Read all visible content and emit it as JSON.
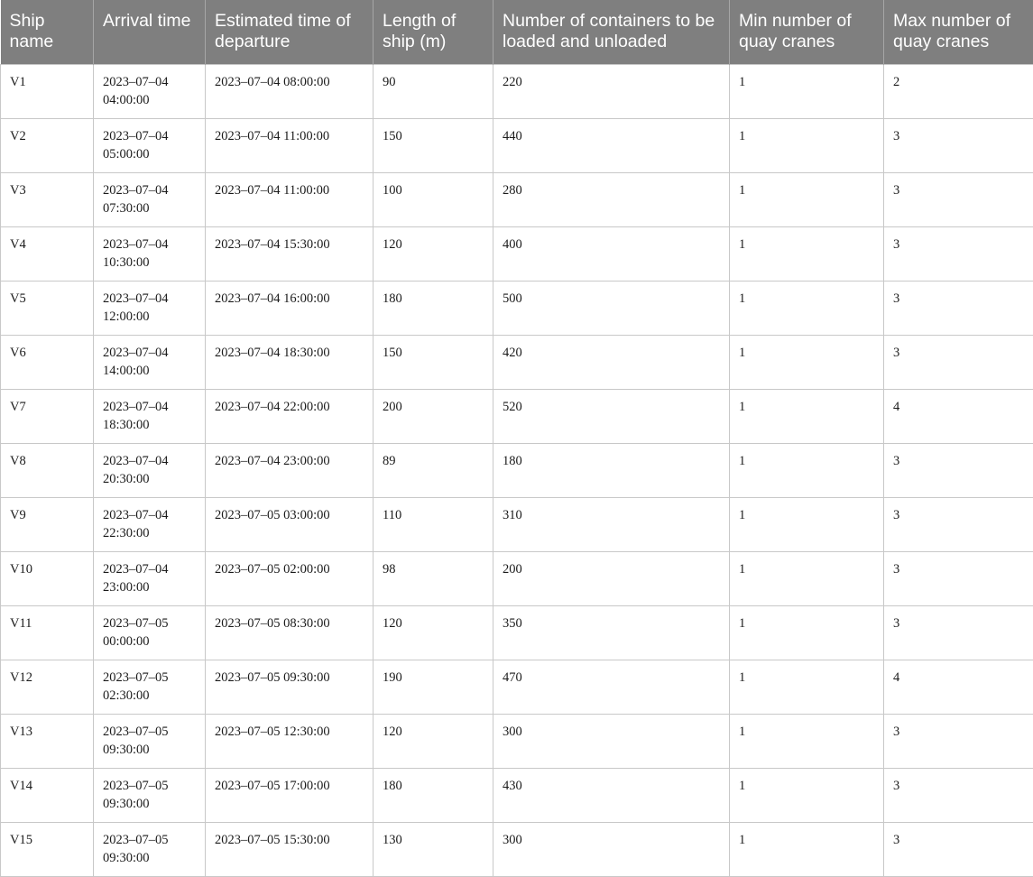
{
  "table": {
    "headers": [
      "Ship name",
      "Arrival time",
      "Estimated time of departure",
      "Length of ship (m)",
      "Number of containers to be loaded and unloaded",
      "Min number of quay cranes",
      "Max number of quay cranes"
    ],
    "rows": [
      [
        "V1",
        "2023–07–04 04:00:00",
        "2023–07–04 08:00:00",
        "90",
        "220",
        "1",
        "2"
      ],
      [
        "V2",
        "2023–07–04 05:00:00",
        "2023–07–04 11:00:00",
        "150",
        "440",
        "1",
        "3"
      ],
      [
        "V3",
        "2023–07–04 07:30:00",
        "2023–07–04 11:00:00",
        "100",
        "280",
        "1",
        "3"
      ],
      [
        "V4",
        "2023–07–04 10:30:00",
        "2023–07–04 15:30:00",
        "120",
        "400",
        "1",
        "3"
      ],
      [
        "V5",
        "2023–07–04 12:00:00",
        "2023–07–04 16:00:00",
        "180",
        "500",
        "1",
        "3"
      ],
      [
        "V6",
        "2023–07–04 14:00:00",
        "2023–07–04 18:30:00",
        "150",
        "420",
        "1",
        "3"
      ],
      [
        "V7",
        "2023–07–04 18:30:00",
        "2023–07–04 22:00:00",
        "200",
        "520",
        "1",
        "4"
      ],
      [
        "V8",
        "2023–07–04 20:30:00",
        "2023–07–04 23:00:00",
        "89",
        "180",
        "1",
        "3"
      ],
      [
        "V9",
        "2023–07–04 22:30:00",
        "2023–07–05 03:00:00",
        "110",
        "310",
        "1",
        "3"
      ],
      [
        "V10",
        "2023–07–04 23:00:00",
        "2023–07–05 02:00:00",
        "98",
        "200",
        "1",
        "3"
      ],
      [
        "V11",
        "2023–07–05 00:00:00",
        "2023–07–05 08:30:00",
        "120",
        "350",
        "1",
        "3"
      ],
      [
        "V12",
        "2023–07–05 02:30:00",
        "2023–07–05 09:30:00",
        "190",
        "470",
        "1",
        "4"
      ],
      [
        "V13",
        "2023–07–05 09:30:00",
        "2023–07–05 12:30:00",
        "120",
        "300",
        "1",
        "3"
      ],
      [
        "V14",
        "2023–07–05 09:30:00",
        "2023–07–05 17:00:00",
        "180",
        "430",
        "1",
        "3"
      ],
      [
        "V15",
        "2023–07–05 09:30:00",
        "2023–07–05 15:30:00",
        "130",
        "300",
        "1",
        "3"
      ]
    ]
  }
}
